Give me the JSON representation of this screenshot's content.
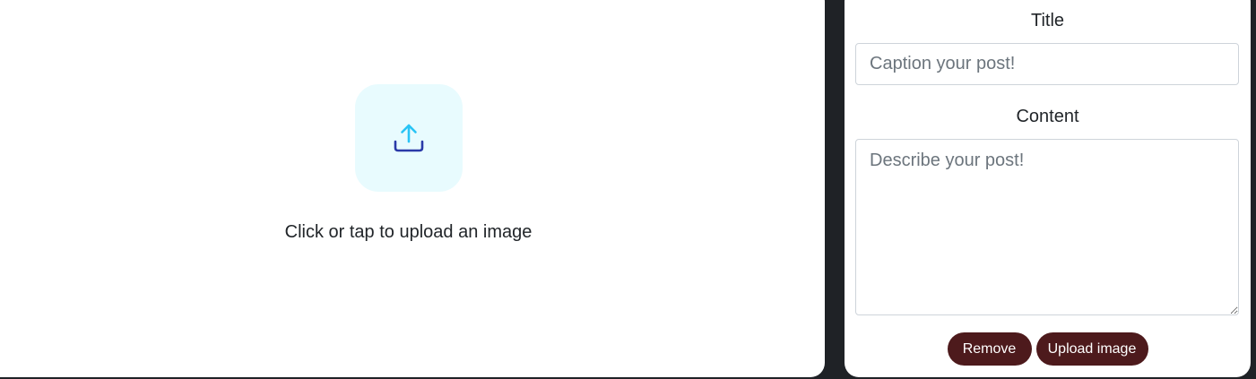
{
  "upload_area": {
    "prompt": "Click or tap to upload an image",
    "icon": "upload-icon",
    "tile_color": "#e8fbfe",
    "icon_arrow_color": "#29c4f5",
    "icon_tray_color": "#2a3aa8"
  },
  "form": {
    "title_label": "Title",
    "title_placeholder": "Caption your post!",
    "title_value": "",
    "content_label": "Content",
    "content_placeholder": "Describe your post!",
    "content_value": "",
    "remove_label": "Remove",
    "upload_label": "Upload image"
  },
  "colors": {
    "background": "#1f2226",
    "panel": "#ffffff",
    "button": "#4d1a1c"
  }
}
